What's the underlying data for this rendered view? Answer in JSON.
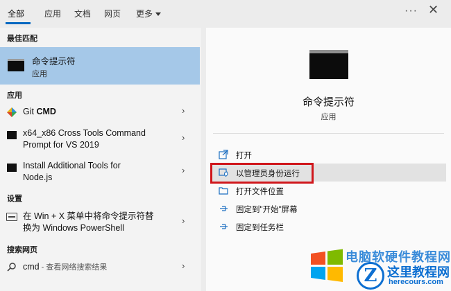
{
  "tabs": {
    "all": "全部",
    "apps": "应用",
    "docs": "文档",
    "web": "网页",
    "more": "更多"
  },
  "top_controls": {
    "options_icon": "ellipsis-icon",
    "close_icon": "close-icon",
    "dots": "···",
    "close": "✕"
  },
  "left": {
    "best_match_header": "最佳匹配",
    "best_match": {
      "title": "命令提示符",
      "subtitle": "应用"
    },
    "apps_header": "应用",
    "apps": [
      {
        "label_plain": "Git ",
        "label_bold": "CMD",
        "icon": "git-icon"
      },
      {
        "line1": "x64_x86 Cross Tools Command",
        "line2": "Prompt for VS 2019",
        "icon": "console-icon"
      },
      {
        "line1": "Install Additional Tools for",
        "line2": "Node.js",
        "icon": "console-icon"
      }
    ],
    "settings_header": "设置",
    "settings": {
      "line1": "在 Win + X 菜单中将命令提示符替",
      "line2": "换为 Windows PowerShell",
      "icon": "settings-icon"
    },
    "web_header": "搜索网页",
    "web": {
      "query": "cmd",
      "suffix": " - 查看网络搜索结果",
      "icon": "search-icon"
    },
    "chevron": "›"
  },
  "right": {
    "title": "命令提示符",
    "subtitle": "应用",
    "actions": [
      {
        "label": "打开",
        "icon": "open-icon"
      },
      {
        "label": "以管理员身份运行",
        "icon": "run-as-admin-icon"
      },
      {
        "label": "打开文件位置",
        "icon": "folder-icon"
      },
      {
        "label": "固定到\"开始\"屏幕",
        "icon": "pin-icon"
      },
      {
        "label": "固定到任务栏",
        "icon": "pin-icon"
      }
    ]
  },
  "watermark": {
    "top_text": "电脑软硬件教程网",
    "badge": "Z",
    "site_cn": "这里教程网",
    "site_en": "herecours.com"
  },
  "colors": {
    "accent": "#0067c0",
    "selection": "#a5c8e8",
    "highlight_border": "#d0161b"
  }
}
